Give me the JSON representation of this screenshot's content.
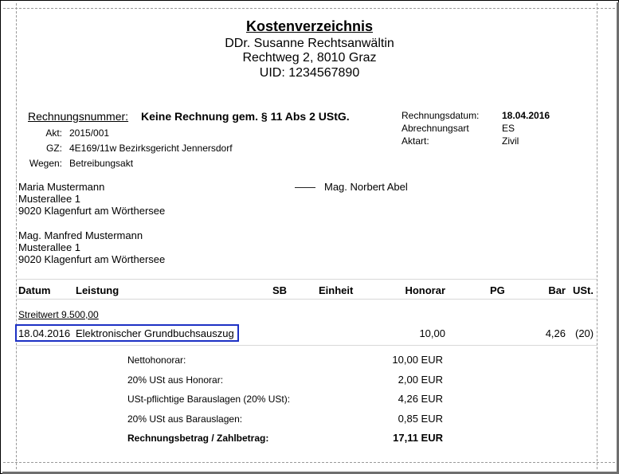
{
  "header": {
    "title": "Kostenverzeichnis",
    "lines": [
      "DDr. Susanne Rechtsanwältin",
      "Rechtweg 2, 8010 Graz",
      "UID: 1234567890"
    ]
  },
  "invoice": {
    "number_label": "Rechnungsnummer:",
    "number_value": "Keine Rechnung gem. § 11 Abs 2 UStG.",
    "fields": [
      {
        "label": "Akt:",
        "value": "2015/001"
      },
      {
        "label": "GZ:",
        "value": "4E169/11w Bezirksgericht Jennersdorf"
      },
      {
        "label": "Wegen:",
        "value": "Betreibungsakt"
      }
    ],
    "meta": [
      {
        "label": "Rechnungsdatum:",
        "value": "18.04.2016"
      },
      {
        "label": "Abrechnungsart",
        "value": "ES"
      },
      {
        "label": "Aktart:",
        "value": "Zivil"
      }
    ]
  },
  "parties": {
    "client": [
      "Maria Mustermann",
      "Musterallee 1",
      "9020 Klagenfurt am Wörthersee"
    ],
    "opponent_dash": "——",
    "opponent": "Mag. Norbert Abel",
    "representative": [
      "Mag. Manfred Mustermann",
      "Musterallee 1",
      "9020 Klagenfurt am Wörthersee"
    ]
  },
  "table": {
    "headers": {
      "datum": "Datum",
      "leistung": "Leistung",
      "sb": "SB",
      "einheit": "Einheit",
      "honorar": "Honorar",
      "pg": "PG",
      "bar": "Bar",
      "ust": "USt."
    },
    "streitwert": "Streitwert 9.500,00",
    "row": {
      "datum": "18.04.2016",
      "leistung": "Elektronischer Grundbuchsauszug",
      "honorar": "10,00",
      "bar": "4,26",
      "ust": "(20)"
    }
  },
  "totals": [
    {
      "label": "Nettohonorar:",
      "value": "10,00 EUR",
      "bold": false
    },
    {
      "label": "20% USt aus Honorar:",
      "value": "2,00 EUR",
      "bold": false
    },
    {
      "label": "USt-pflichtige Barauslagen (20% USt):",
      "value": "4,26 EUR",
      "bold": false
    },
    {
      "label": "20% USt aus Barauslagen:",
      "value": "0,85 EUR",
      "bold": false
    },
    {
      "label": "Rechnungsbetrag / Zahlbetrag:",
      "value": "17,11 EUR",
      "bold": true
    }
  ],
  "colors": {
    "highlight_border": "#1c30c4",
    "frame_shadow": "#6e6e6e"
  }
}
